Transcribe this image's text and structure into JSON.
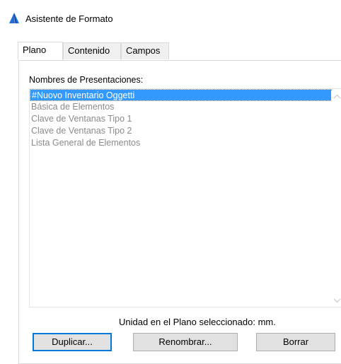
{
  "window": {
    "title": "Asistente de Formato",
    "accent_color": "#1e6fd9"
  },
  "tabs": [
    {
      "label": "Plano",
      "active": true
    },
    {
      "label": "Contenido",
      "active": false
    },
    {
      "label": "Campos",
      "active": false
    }
  ],
  "presentations": {
    "label": "Nombres de Presentaciones:",
    "items": [
      {
        "label": "#Nuovo Inventario Oggetti",
        "selected": true
      },
      {
        "label": "Básica de Elementos",
        "selected": false
      },
      {
        "label": "Clave de Ventanas Tipo 1",
        "selected": false
      },
      {
        "label": "Clave de Ventanas Tipo 2",
        "selected": false
      },
      {
        "label": "Lista General de Elementos",
        "selected": false
      }
    ],
    "selection_color": "#3399ff"
  },
  "unit_text": "Unidad en el Plano seleccionado: mm.",
  "buttons": {
    "duplicate": "Duplicar...",
    "rename": "Renombrar...",
    "delete": "Borrar"
  }
}
